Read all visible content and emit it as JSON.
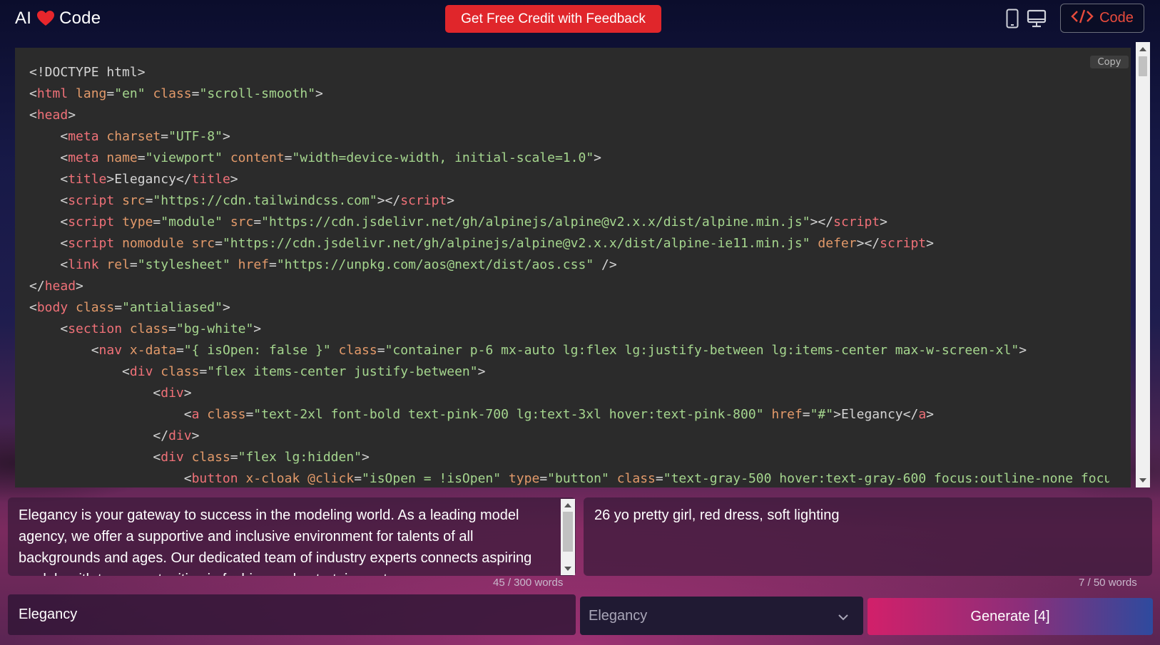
{
  "header": {
    "logo_left": "AI",
    "logo_right": "Code",
    "feedback_label": "Get Free Credit with Feedback",
    "code_toggle_label": "Code"
  },
  "colors": {
    "feedback_red": "#e0262b",
    "heart_red": "#e8262c",
    "code_accent": "#e84b3c",
    "generate_gradient_start": "#d2206a",
    "generate_gradient_end": "#2e4a9e",
    "code_bg": "#2b2b2b"
  },
  "icons": [
    "mobile-view-icon",
    "desktop-view-icon",
    "code-brackets-icon",
    "heart-icon",
    "chevron-down-icon"
  ],
  "code_panel": {
    "copy_label": "Copy",
    "lines": [
      [
        [
          "p",
          "<!DOCTYPE html>"
        ]
      ],
      [
        [
          "p",
          "<"
        ],
        [
          "t",
          "html"
        ],
        [
          "p",
          " "
        ],
        [
          "a",
          "lang"
        ],
        [
          "p",
          "="
        ],
        [
          "s",
          "\"en\""
        ],
        [
          "p",
          " "
        ],
        [
          "a",
          "class"
        ],
        [
          "p",
          "="
        ],
        [
          "s",
          "\"scroll-smooth\""
        ],
        [
          "p",
          ">"
        ]
      ],
      [
        [
          "p",
          "<"
        ],
        [
          "t",
          "head"
        ],
        [
          "p",
          ">"
        ]
      ],
      [
        [
          "p",
          "    <"
        ],
        [
          "t",
          "meta"
        ],
        [
          "p",
          " "
        ],
        [
          "a",
          "charset"
        ],
        [
          "p",
          "="
        ],
        [
          "s",
          "\"UTF-8\""
        ],
        [
          "p",
          ">"
        ]
      ],
      [
        [
          "p",
          "    <"
        ],
        [
          "t",
          "meta"
        ],
        [
          "p",
          " "
        ],
        [
          "a",
          "name"
        ],
        [
          "p",
          "="
        ],
        [
          "s",
          "\"viewport\""
        ],
        [
          "p",
          " "
        ],
        [
          "a",
          "content"
        ],
        [
          "p",
          "="
        ],
        [
          "s",
          "\"width=device-width, initial-scale=1.0\""
        ],
        [
          "p",
          ">"
        ]
      ],
      [
        [
          "p",
          "    <"
        ],
        [
          "t",
          "title"
        ],
        [
          "p",
          ">Elegancy</"
        ],
        [
          "t",
          "title"
        ],
        [
          "p",
          ">"
        ]
      ],
      [
        [
          "p",
          "    <"
        ],
        [
          "t",
          "script"
        ],
        [
          "p",
          " "
        ],
        [
          "a",
          "src"
        ],
        [
          "p",
          "="
        ],
        [
          "s",
          "\"https://cdn.tailwindcss.com\""
        ],
        [
          "p",
          "></"
        ],
        [
          "t",
          "script"
        ],
        [
          "p",
          ">"
        ]
      ],
      [
        [
          "p",
          "    <"
        ],
        [
          "t",
          "script"
        ],
        [
          "p",
          " "
        ],
        [
          "a",
          "type"
        ],
        [
          "p",
          "="
        ],
        [
          "s",
          "\"module\""
        ],
        [
          "p",
          " "
        ],
        [
          "a",
          "src"
        ],
        [
          "p",
          "="
        ],
        [
          "s",
          "\"https://cdn.jsdelivr.net/gh/alpinejs/alpine@v2.x.x/dist/alpine.min.js\""
        ],
        [
          "p",
          "></"
        ],
        [
          "t",
          "script"
        ],
        [
          "p",
          ">"
        ]
      ],
      [
        [
          "p",
          "    <"
        ],
        [
          "t",
          "script"
        ],
        [
          "p",
          " "
        ],
        [
          "a",
          "nomodule"
        ],
        [
          "p",
          " "
        ],
        [
          "a",
          "src"
        ],
        [
          "p",
          "="
        ],
        [
          "s",
          "\"https://cdn.jsdelivr.net/gh/alpinejs/alpine@v2.x.x/dist/alpine-ie11.min.js\""
        ],
        [
          "p",
          " "
        ],
        [
          "a",
          "defer"
        ],
        [
          "p",
          "></"
        ],
        [
          "t",
          "script"
        ],
        [
          "p",
          ">"
        ]
      ],
      [
        [
          "p",
          "    <"
        ],
        [
          "t",
          "link"
        ],
        [
          "p",
          " "
        ],
        [
          "a",
          "rel"
        ],
        [
          "p",
          "="
        ],
        [
          "s",
          "\"stylesheet\""
        ],
        [
          "p",
          " "
        ],
        [
          "a",
          "href"
        ],
        [
          "p",
          "="
        ],
        [
          "s",
          "\"https://unpkg.com/aos@next/dist/aos.css\""
        ],
        [
          "p",
          " />"
        ]
      ],
      [
        [
          "p",
          "</"
        ],
        [
          "t",
          "head"
        ],
        [
          "p",
          ">"
        ]
      ],
      [
        [
          "p",
          "<"
        ],
        [
          "t",
          "body"
        ],
        [
          "p",
          " "
        ],
        [
          "a",
          "class"
        ],
        [
          "p",
          "="
        ],
        [
          "s",
          "\"antialiased\""
        ],
        [
          "p",
          ">"
        ]
      ],
      [
        [
          "p",
          "    <"
        ],
        [
          "t",
          "section"
        ],
        [
          "p",
          " "
        ],
        [
          "a",
          "class"
        ],
        [
          "p",
          "="
        ],
        [
          "s",
          "\"bg-white\""
        ],
        [
          "p",
          ">"
        ]
      ],
      [
        [
          "p",
          "        <"
        ],
        [
          "t",
          "nav"
        ],
        [
          "p",
          " "
        ],
        [
          "a",
          "x-data"
        ],
        [
          "p",
          "="
        ],
        [
          "s",
          "\"{ isOpen: false }\""
        ],
        [
          "p",
          " "
        ],
        [
          "a",
          "class"
        ],
        [
          "p",
          "="
        ],
        [
          "s",
          "\"container p-6 mx-auto lg:flex lg:justify-between lg:items-center max-w-screen-xl\""
        ],
        [
          "p",
          ">"
        ]
      ],
      [
        [
          "p",
          "            <"
        ],
        [
          "t",
          "div"
        ],
        [
          "p",
          " "
        ],
        [
          "a",
          "class"
        ],
        [
          "p",
          "="
        ],
        [
          "s",
          "\"flex items-center justify-between\""
        ],
        [
          "p",
          ">"
        ]
      ],
      [
        [
          "p",
          "                <"
        ],
        [
          "t",
          "div"
        ],
        [
          "p",
          ">"
        ]
      ],
      [
        [
          "p",
          "                    <"
        ],
        [
          "t",
          "a"
        ],
        [
          "p",
          " "
        ],
        [
          "a",
          "class"
        ],
        [
          "p",
          "="
        ],
        [
          "s",
          "\"text-2xl font-bold text-pink-700 lg:text-3xl hover:text-pink-800\""
        ],
        [
          "p",
          " "
        ],
        [
          "a",
          "href"
        ],
        [
          "p",
          "="
        ],
        [
          "s",
          "\"#\""
        ],
        [
          "p",
          ">Elegancy</"
        ],
        [
          "t",
          "a"
        ],
        [
          "p",
          ">"
        ]
      ],
      [
        [
          "p",
          "                </"
        ],
        [
          "t",
          "div"
        ],
        [
          "p",
          ">"
        ]
      ],
      [
        [
          "p",
          "                <"
        ],
        [
          "t",
          "div"
        ],
        [
          "p",
          " "
        ],
        [
          "a",
          "class"
        ],
        [
          "p",
          "="
        ],
        [
          "s",
          "\"flex lg:hidden\""
        ],
        [
          "p",
          ">"
        ]
      ],
      [
        [
          "p",
          "                    <"
        ],
        [
          "t",
          "button"
        ],
        [
          "p",
          " "
        ],
        [
          "a",
          "x-cloak"
        ],
        [
          "p",
          " "
        ],
        [
          "a",
          "@click"
        ],
        [
          "p",
          "="
        ],
        [
          "s",
          "\"isOpen = !isOpen\""
        ],
        [
          "p",
          " "
        ],
        [
          "a",
          "type"
        ],
        [
          "p",
          "="
        ],
        [
          "s",
          "\"button\""
        ],
        [
          "p",
          " "
        ],
        [
          "a",
          "class"
        ],
        [
          "p",
          "="
        ],
        [
          "s",
          "\"text-gray-500 hover:text-gray-600 focus:outline-none focu"
        ]
      ]
    ]
  },
  "description": {
    "text": "Elegancy is your gateway to success in the modeling world. As a leading model agency, we offer a supportive and inclusive environment for talents of all backgrounds and ages. Our dedicated team of industry experts connects aspiring models with top opportunities in fashion and entertainment.",
    "counter": "45 / 300 words"
  },
  "prompt": {
    "text": "26 yo pretty girl, red dress, soft lighting",
    "counter": "7 / 50 words"
  },
  "site_name": {
    "value": "Elegancy"
  },
  "select": {
    "selected": "Elegancy"
  },
  "generate_label": "Generate [4]"
}
